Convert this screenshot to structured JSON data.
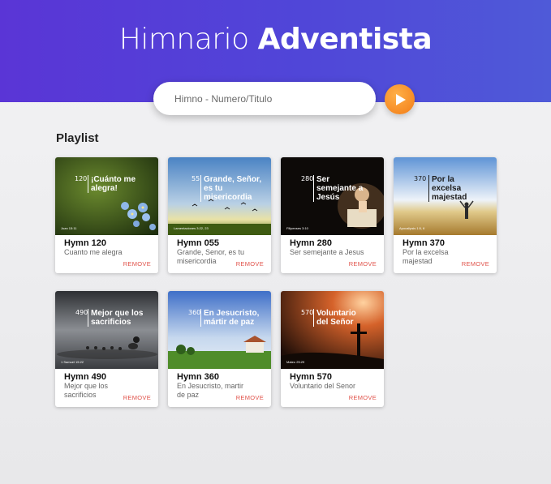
{
  "header": {
    "title_light": "Himnario",
    "title_bold": "Adventista",
    "gradient_start": "#5a35d6",
    "gradient_end": "#4f5ad8"
  },
  "search": {
    "placeholder": "Himno - Numero/Titulo",
    "value": "",
    "play_icon": "play-icon",
    "button_color": "#f7901e"
  },
  "playlist": {
    "title": "Playlist",
    "remove_label": "REMOVE",
    "remove_color": "#e0524a",
    "items": [
      {
        "name": "Hymn 120",
        "subtitle": "Cuanto me alegra",
        "thumb_number": "120",
        "thumb_title": "¡Cuánto me alegra!",
        "thumb_ref": "Juan 15:11"
      },
      {
        "name": "Hymn 055",
        "subtitle": "Grande, Senor, es tu misericordia",
        "thumb_number": "55",
        "thumb_title": "Grande, Señor, es tu misericordia",
        "thumb_ref": "Lamentaciones 3:22, 23"
      },
      {
        "name": "Hymn 280",
        "subtitle": "Ser semejante a Jesus",
        "thumb_number": "280",
        "thumb_title": "Ser semejante a Jesús",
        "thumb_ref": "Filipenses 3:10"
      },
      {
        "name": "Hymn 370",
        "subtitle": "Por la excelsa majestad",
        "thumb_number": "370",
        "thumb_title": "Por la excelsa majestad",
        "thumb_ref": "Apocalipsis 1:5, 6"
      },
      {
        "name": "Hymn 490",
        "subtitle": "Mejor que los sacrificios",
        "thumb_number": "490",
        "thumb_title": "Mejor que los sacrificios",
        "thumb_ref": "1 Samuel 15:22"
      },
      {
        "name": "Hymn 360",
        "subtitle": "En Jesucristo, martir de paz",
        "thumb_number": "360",
        "thumb_title": "En Jesucristo, mártir de paz",
        "thumb_ref": ""
      },
      {
        "name": "Hymn 570",
        "subtitle": "Voluntario del Senor",
        "thumb_number": "570",
        "thumb_title": "Voluntario del Señor",
        "thumb_ref": "Mateo 25:29"
      }
    ]
  }
}
